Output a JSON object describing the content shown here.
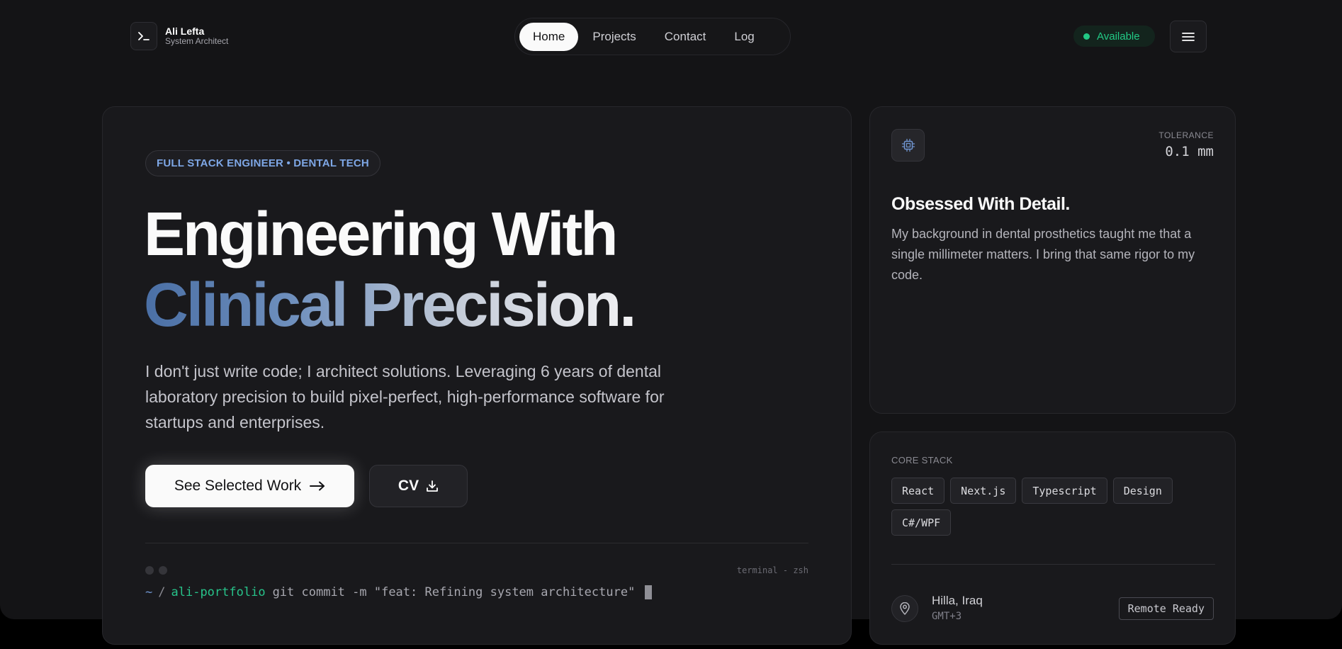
{
  "header": {
    "brand_name": "Ali Lefta",
    "brand_role": "System Architect",
    "nav": [
      "Home",
      "Projects",
      "Contact",
      "Log"
    ],
    "status": "Available"
  },
  "hero": {
    "tag": "FULL STACK ENGINEER • DENTAL TECH",
    "title_line1": "Engineering With",
    "title_line2": "Clinical Precision.",
    "description": "I don't just write code; I architect solutions. Leveraging 6 years of dental laboratory precision to build pixel-perfect, high-performance software for startups and enterprises.",
    "primary_button": "See Selected Work",
    "cv_button": "CV",
    "terminal": {
      "title": "terminal - zsh",
      "tilde": "~",
      "separator": "/",
      "repo": "ali-portfolio",
      "command": "git commit -m \"feat: Refining system architecture\""
    }
  },
  "detail": {
    "tolerance_label": "TOLERANCE",
    "tolerance_value": "0.1 mm",
    "title": "Obsessed With Detail.",
    "text": "My background in dental prosthetics taught me that a single millimeter matters. I bring that same rigor to my code."
  },
  "stack": {
    "label": "CORE STACK",
    "tags": [
      "React",
      "Next.js",
      "Typescript",
      "Design",
      "C#/WPF"
    ],
    "location_city": "Hilla, Iraq",
    "location_tz": "GMT+3",
    "remote_label": "Remote Ready"
  },
  "colors": {
    "accent_blue": "#7ea7e6",
    "status_green": "#22c985",
    "card_bg": "#19191c",
    "page_bg": "#141416"
  },
  "icons": [
    "terminal-icon",
    "menu-icon",
    "arrow-right-icon",
    "download-icon",
    "chip-icon",
    "map-pin-icon"
  ]
}
